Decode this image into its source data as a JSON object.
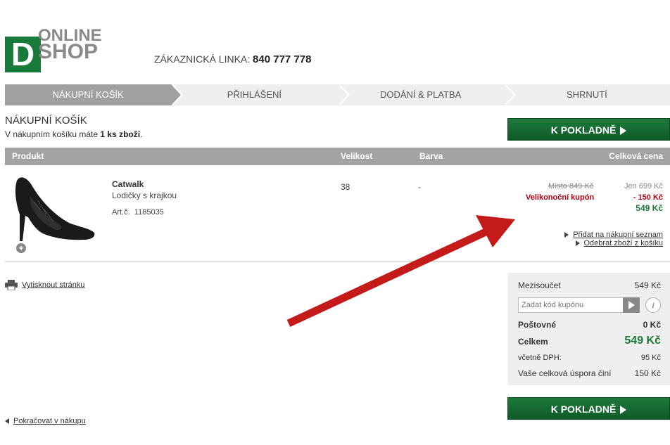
{
  "brand": {
    "logo_letter": "D",
    "logo_line1": "ONLINE",
    "logo_line2": "SHOP",
    "green": "#1a7a3a"
  },
  "header": {
    "hotline_label": "ZÁKAZNICKÁ LINKA:",
    "hotline_number": "840 777 778"
  },
  "steps": [
    {
      "label": "NÁKUPNÍ KOŠÍK",
      "active": true
    },
    {
      "label": "PŘIHLÁŠENÍ",
      "active": false
    },
    {
      "label": "DODÁNÍ & PLATBA",
      "active": false
    },
    {
      "label": "SHRNUTÍ",
      "active": false
    }
  ],
  "cart": {
    "title": "NÁKUPNÍ KOŠÍK",
    "count_prefix": "V nákupním košíku máte ",
    "count_bold": "1 ks zboží",
    "count_suffix": ".",
    "checkout_label": "K POKLADNĚ"
  },
  "table": {
    "headers": {
      "product": "Produkt",
      "size": "Velikost",
      "color": "Barva",
      "total": "Celková cena"
    }
  },
  "item": {
    "name": "Catwalk",
    "desc": "Lodičky s krajkou",
    "art_label": "Art.č.",
    "art_number": "1185035",
    "size": "38",
    "color": "-",
    "orig_price": "Místo 849 Kč",
    "only_price": "Jen 699 Kč",
    "coupon_label": "Velikonoční kupón",
    "discount": "- 150 Kč",
    "final_price": "549 Kč",
    "add_wishlist": "Přidat na nákupní seznam",
    "remove": "Odebrat zboží z košíku",
    "zoom_icon": "+"
  },
  "print_label": "Vytisknout stránku",
  "summary": {
    "subtotal_label": "Mezisoučet",
    "subtotal_value": "549 Kč",
    "coupon_placeholder": "Zadat kód kupónu",
    "info_icon": "i",
    "shipping_label": "Poštovné",
    "shipping_value": "0 Kč",
    "total_label": "Celkem",
    "total_value": "549 Kč",
    "vat_label": "včetně DPH:",
    "vat_value": "95 Kč",
    "saving_label": "Vaše celková úspora činí",
    "saving_value": "150 Kč"
  },
  "continue_label": "Pokračovat v nákupu",
  "colors": {
    "accent_red": "#c41a1a",
    "discount_red": "#b00010",
    "price_green": "#1a7a3a"
  }
}
